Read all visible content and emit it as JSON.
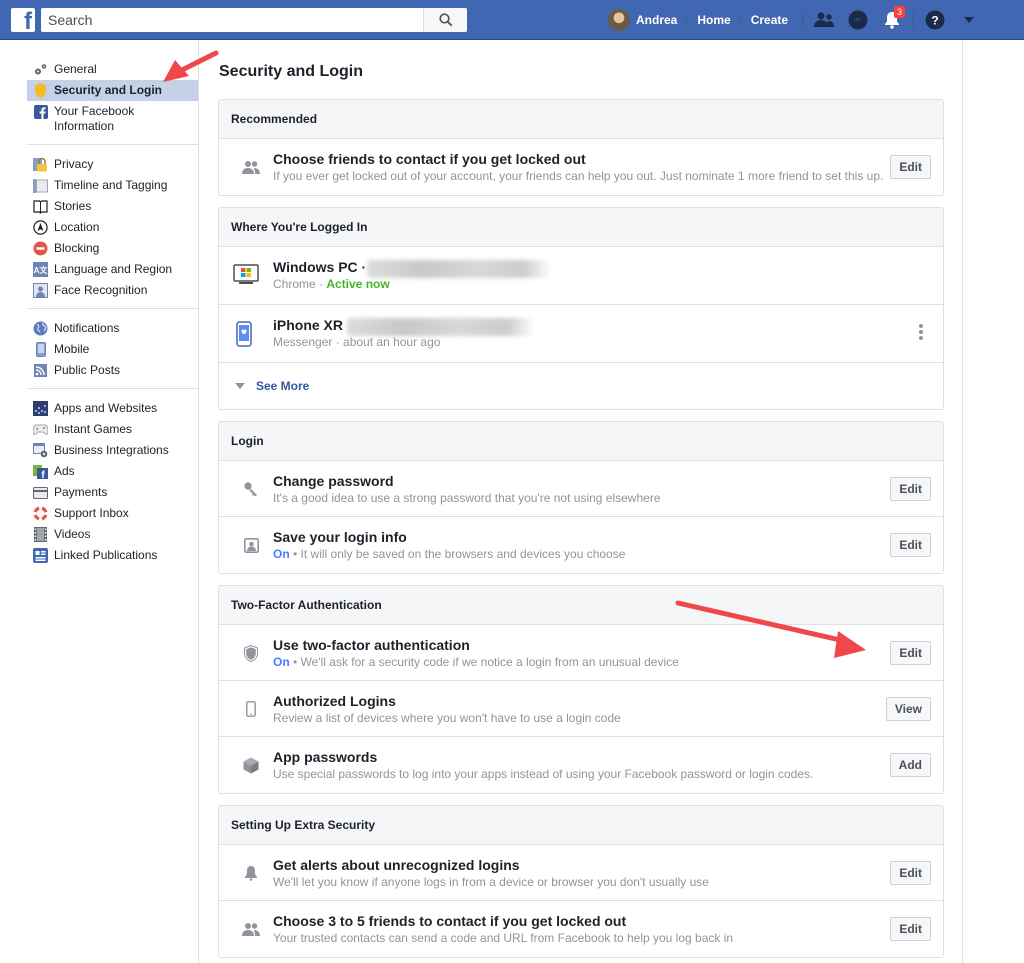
{
  "topbar": {
    "logo": "f",
    "search_placeholder": "Search",
    "user_name": "Andrea",
    "home_label": "Home",
    "create_label": "Create",
    "notification_count": "3",
    "icons": [
      "friends-icon",
      "messenger-icon",
      "notifications-icon",
      "help-icon",
      "dropdown-icon"
    ]
  },
  "sidebar": {
    "groups": [
      [
        {
          "label": "General",
          "icon": "gears-icon"
        },
        {
          "label": "Security and Login",
          "icon": "shield-badge-icon",
          "active": true
        },
        {
          "label": "Your Facebook Information",
          "icon": "facebook-icon"
        }
      ],
      [
        {
          "label": "Privacy",
          "icon": "lock-icon"
        },
        {
          "label": "Timeline and Tagging",
          "icon": "timeline-icon"
        },
        {
          "label": "Stories",
          "icon": "book-icon"
        },
        {
          "label": "Location",
          "icon": "location-icon"
        },
        {
          "label": "Blocking",
          "icon": "blocking-icon"
        },
        {
          "label": "Language and Region",
          "icon": "language-icon"
        },
        {
          "label": "Face Recognition",
          "icon": "face-recognition-icon"
        }
      ],
      [
        {
          "label": "Notifications",
          "icon": "globe-icon"
        },
        {
          "label": "Mobile",
          "icon": "mobile-icon"
        },
        {
          "label": "Public Posts",
          "icon": "rss-icon"
        }
      ],
      [
        {
          "label": "Apps and Websites",
          "icon": "apps-icon"
        },
        {
          "label": "Instant Games",
          "icon": "gamepad-icon"
        },
        {
          "label": "Business Integrations",
          "icon": "business-icon"
        },
        {
          "label": "Ads",
          "icon": "ads-icon"
        },
        {
          "label": "Payments",
          "icon": "card-icon"
        },
        {
          "label": "Support Inbox",
          "icon": "lifebuoy-icon"
        },
        {
          "label": "Videos",
          "icon": "film-icon"
        },
        {
          "label": "Linked Publications",
          "icon": "publication-icon"
        }
      ]
    ]
  },
  "main": {
    "title": "Security and Login",
    "recommended": {
      "header": "Recommended",
      "rows": [
        {
          "title": "Choose friends to contact if you get locked out",
          "subtitle": "If you ever get locked out of your account, your friends can help you out. Just nominate 1 more friend to set this up.",
          "button": "Edit"
        }
      ]
    },
    "logged_in": {
      "header": "Where You're Logged In",
      "sessions": [
        {
          "device": "Windows PC ·",
          "app": "Chrome · ",
          "status": "Active now"
        },
        {
          "device": "iPhone XR",
          "app": "Messenger · about an hour ago",
          "status": ""
        }
      ],
      "see_more": "See More"
    },
    "login": {
      "header": "Login",
      "rows": [
        {
          "title": "Change password",
          "subtitle": "It's a good idea to use a strong password that you're not using elsewhere",
          "button": "Edit"
        },
        {
          "title": "Save your login info",
          "status": "On",
          "subtitle": " • It will only be saved on the browsers and devices you choose",
          "button": "Edit"
        }
      ]
    },
    "two_factor": {
      "header": "Two-Factor Authentication",
      "rows": [
        {
          "title": "Use two-factor authentication",
          "status": "On",
          "subtitle": " • We'll ask for a security code if we notice a login from an unusual device",
          "button": "Edit"
        },
        {
          "title": "Authorized Logins",
          "subtitle": "Review a list of devices where you won't have to use a login code",
          "button": "View"
        },
        {
          "title": "App passwords",
          "subtitle": "Use special passwords to log into your apps instead of using your Facebook password or login codes.",
          "button": "Add"
        }
      ]
    },
    "extra_security": {
      "header": "Setting Up Extra Security",
      "rows": [
        {
          "title": "Get alerts about unrecognized logins",
          "subtitle": "We'll let you know if anyone logs in from a device or browser you don't usually use",
          "button": "Edit"
        },
        {
          "title": "Choose 3 to 5 friends to contact if you get locked out",
          "subtitle": "Your trusted contacts can send a code and URL from Facebook to help you log back in",
          "button": "Edit"
        }
      ]
    }
  },
  "colors": {
    "brand": "#4267b2",
    "active_nav": "#c4d2e7",
    "on_status": "#4080ff",
    "active_now": "#42b72a",
    "annotation_arrow": "#f0474b"
  }
}
